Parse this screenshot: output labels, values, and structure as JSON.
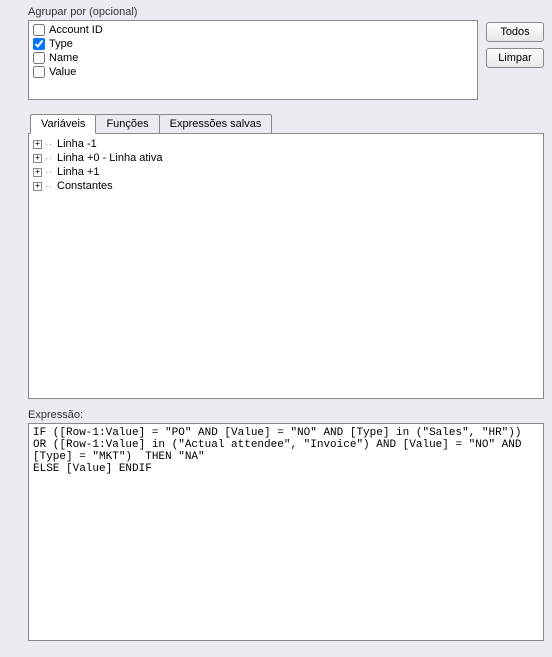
{
  "groupby": {
    "label": "Agrupar por (opcional)",
    "items": [
      {
        "label": "Account ID",
        "checked": false
      },
      {
        "label": "Type",
        "checked": true
      },
      {
        "label": "Name",
        "checked": false
      },
      {
        "label": "Value",
        "checked": false
      }
    ],
    "btn_all": "Todos",
    "btn_clear": "Limpar"
  },
  "tabs": {
    "variables": "Variáveis",
    "functions": "Funções",
    "saved": "Expressões salvas"
  },
  "tree": {
    "items": [
      {
        "label": "Linha -1"
      },
      {
        "label": "Linha +0 - Linha ativa"
      },
      {
        "label": "Linha +1"
      },
      {
        "label": "Constantes"
      }
    ]
  },
  "expression": {
    "label": "Expressão:",
    "value": "IF ([Row-1:Value] = \"PO\" AND [Value] = \"NO\" AND [Type] in (\"Sales\", \"HR\")) OR ([Row-1:Value] in (\"Actual attendee\", \"Invoice\") AND [Value] = \"NO\" AND [Type] = \"MKT\")  THEN \"NA\"\nELSE [Value] ENDIF"
  }
}
